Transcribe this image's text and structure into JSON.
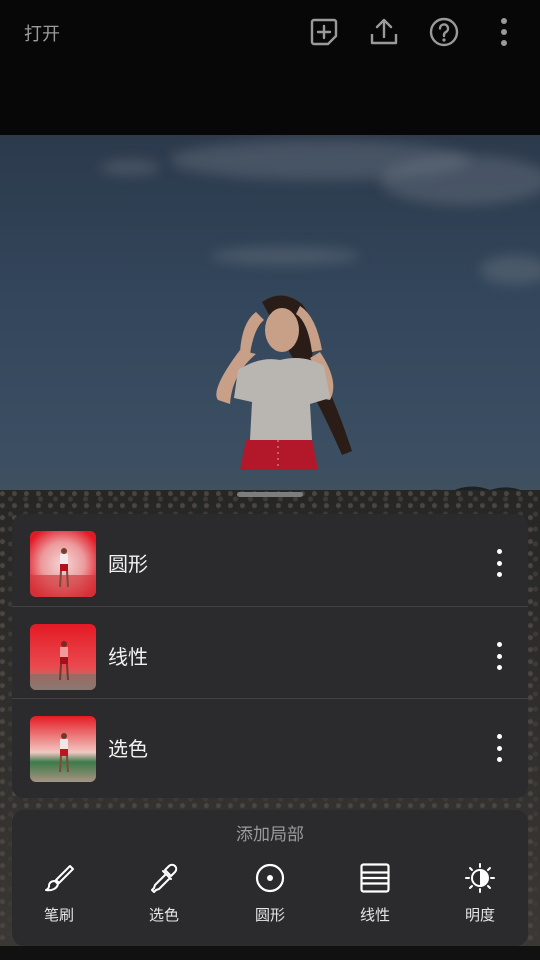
{
  "header": {
    "open_label": "打开",
    "icons": [
      "add-layer-icon",
      "export-icon",
      "help-icon",
      "more-vertical-icon"
    ]
  },
  "local_layers": {
    "items": [
      {
        "label": "圆形",
        "thumb_style": "radial"
      },
      {
        "label": "线性",
        "thumb_style": "linear"
      },
      {
        "label": "选色",
        "thumb_style": "color"
      }
    ]
  },
  "add_local": {
    "title": "添加局部",
    "tools": [
      {
        "label": "笔刷",
        "icon": "brush-icon"
      },
      {
        "label": "选色",
        "icon": "eyedropper-icon"
      },
      {
        "label": "圆形",
        "icon": "radial-icon"
      },
      {
        "label": "线性",
        "icon": "linear-icon"
      },
      {
        "label": "明度",
        "icon": "luminance-icon"
      }
    ]
  },
  "colors": {
    "panel": "#2b2b2d",
    "mask_red": "#e8202a",
    "background": "#070707"
  }
}
